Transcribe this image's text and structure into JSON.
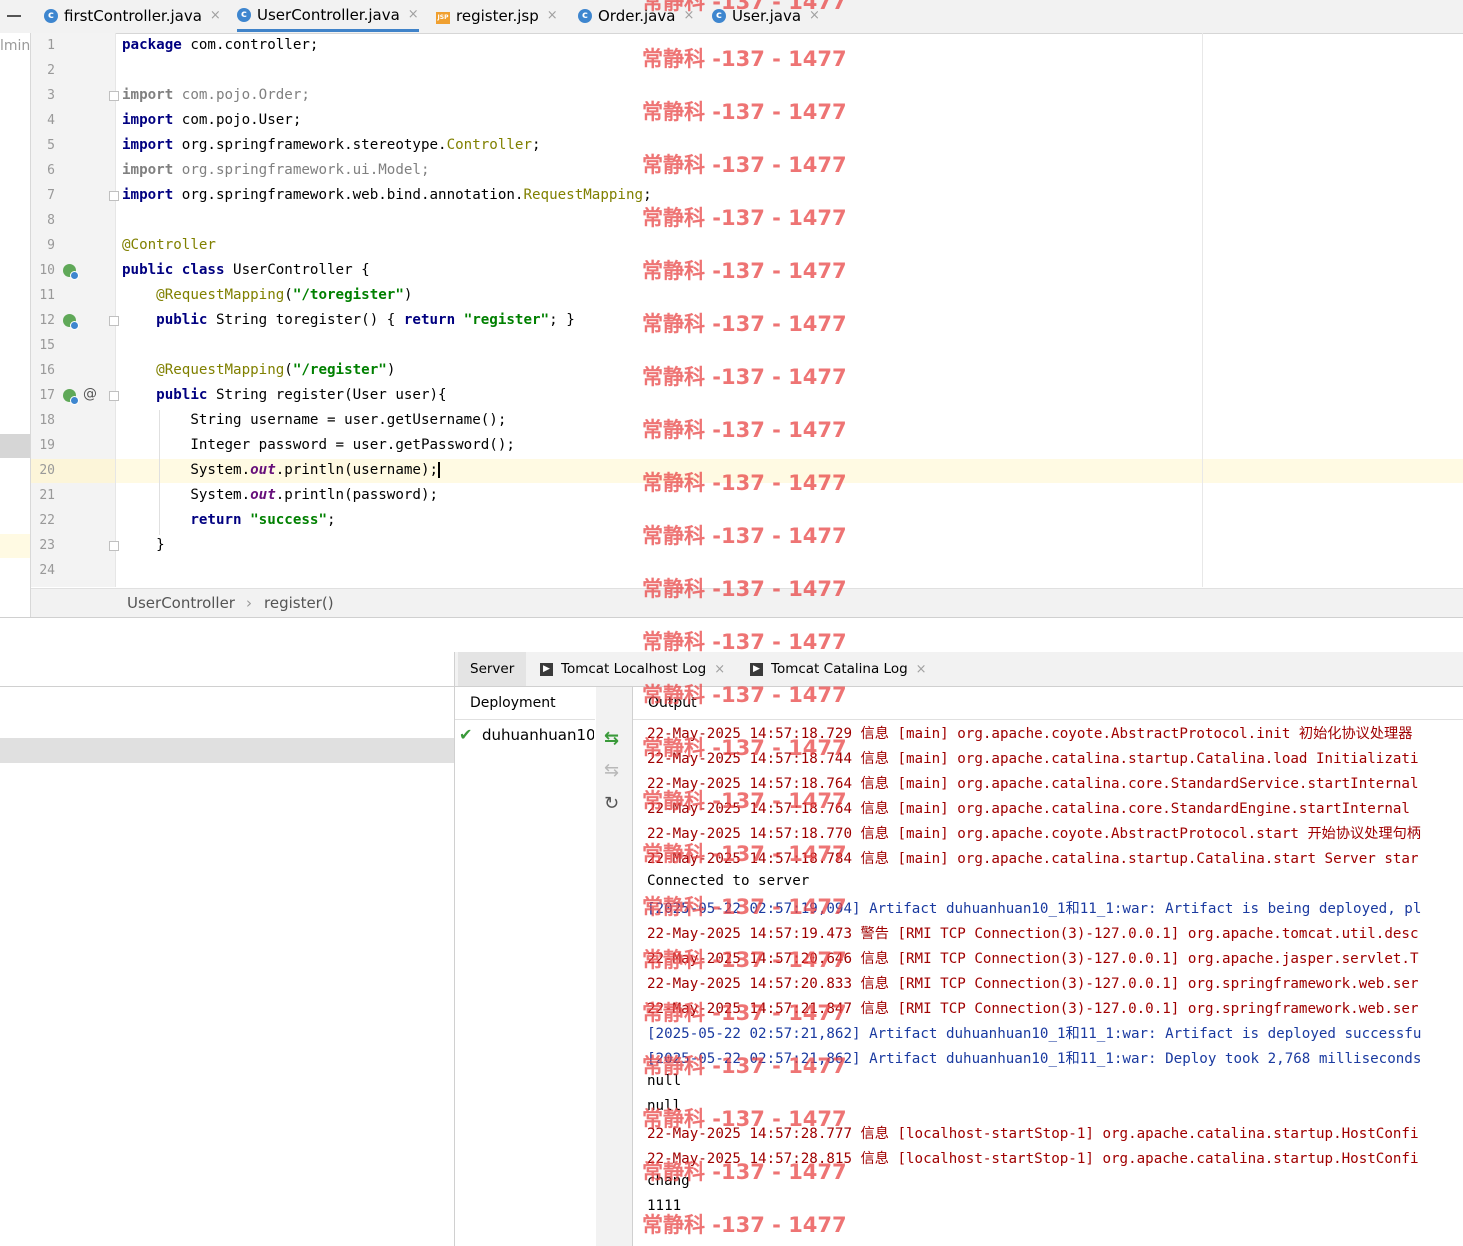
{
  "tabs": [
    {
      "label": "firstController.java",
      "icon": "java-class-icon"
    },
    {
      "label": "UserController.java",
      "icon": "java-class-icon",
      "active": true
    },
    {
      "label": "register.jsp",
      "icon": "jsp-icon"
    },
    {
      "label": "Order.java",
      "icon": "java-class-icon"
    },
    {
      "label": "User.java",
      "icon": "java-class-icon"
    }
  ],
  "tab_close": "×",
  "left_strip_label": "lmin",
  "editor": {
    "line_numbers": [
      "1",
      "2",
      "3",
      "4",
      "5",
      "6",
      "7",
      "8",
      "9",
      "10",
      "11",
      "12",
      "15",
      "16",
      "17",
      "18",
      "19",
      "20",
      "21",
      "22",
      "23",
      "24"
    ],
    "current_line": "20"
  },
  "breadcrumb": {
    "class": "UserController",
    "sep": "›",
    "method": "register()"
  },
  "server_tabs": [
    {
      "label": "Server"
    },
    {
      "label": "Tomcat Localhost Log"
    },
    {
      "label": "Tomcat Catalina Log"
    }
  ],
  "deployment": {
    "header": "Deployment",
    "item": "duhuanhuan10_"
  },
  "output": {
    "header": "Output",
    "lines": [
      {
        "text": "22-May-2025 14:57:18.729 信息 [main] org.apache.coyote.AbstractProtocol.init 初始化协议处理器",
        "style": "red"
      },
      {
        "text": "22-May-2025 14:57:18.744 信息 [main] org.apache.catalina.startup.Catalina.load Initializati",
        "style": "red"
      },
      {
        "text": "22-May-2025 14:57:18.764 信息 [main] org.apache.catalina.core.StandardService.startInternal",
        "style": "red"
      },
      {
        "text": "22-May-2025 14:57:18.764 信息 [main] org.apache.catalina.core.StandardEngine.startInternal",
        "style": "red"
      },
      {
        "text": "22-May-2025 14:57:18.770 信息 [main] org.apache.coyote.AbstractProtocol.start 开始协议处理句柄",
        "style": "red"
      },
      {
        "text": "22-May-2025 14:57:18.784 信息 [main] org.apache.catalina.startup.Catalina.start Server star",
        "style": "red"
      },
      {
        "text": "Connected to server",
        "style": "black"
      },
      {
        "text": "[2025-05-22 02:57:19,094] Artifact duhuanhuan10_1和11_1:war: Artifact is being deployed, pl",
        "style": "blue"
      },
      {
        "text": "22-May-2025 14:57:19.473 警告 [RMI TCP Connection(3)-127.0.0.1] org.apache.tomcat.util.desc",
        "style": "red"
      },
      {
        "text": "22-May-2025 14:57:20.646 信息 [RMI TCP Connection(3)-127.0.0.1] org.apache.jasper.servlet.T",
        "style": "red"
      },
      {
        "text": "22-May-2025 14:57:20.833 信息 [RMI TCP Connection(3)-127.0.0.1] org.springframework.web.ser",
        "style": "red"
      },
      {
        "text": "22-May-2025 14:57:21.847 信息 [RMI TCP Connection(3)-127.0.0.1] org.springframework.web.ser",
        "style": "red"
      },
      {
        "text": "[2025-05-22 02:57:21,862] Artifact duhuanhuan10_1和11_1:war: Artifact is deployed successfu",
        "style": "blue"
      },
      {
        "text": "[2025-05-22 02:57:21,862] Artifact duhuanhuan10_1和11_1:war: Deploy took 2,768 milliseconds",
        "style": "blue"
      },
      {
        "text": "null",
        "style": "black"
      },
      {
        "text": "null",
        "style": "black"
      },
      {
        "text": "22-May-2025 14:57:28.777 信息 [localhost-startStop-1] org.apache.catalina.startup.HostConfi",
        "style": "red"
      },
      {
        "text": "22-May-2025 14:57:28.815 信息 [localhost-startStop-1] org.apache.catalina.startup.HostConfi",
        "style": "red"
      },
      {
        "text": "chang",
        "style": "black"
      },
      {
        "text": "1111",
        "style": "black"
      }
    ]
  },
  "watermark": "常静科 -137 - 1477",
  "colors": {
    "accent": "#4083c9",
    "keyword": "#000080",
    "string": "#008000",
    "annotation": "#808000",
    "log_red": "#a00000",
    "log_blue": "#1a3aa0",
    "watermark": "#e84646"
  }
}
